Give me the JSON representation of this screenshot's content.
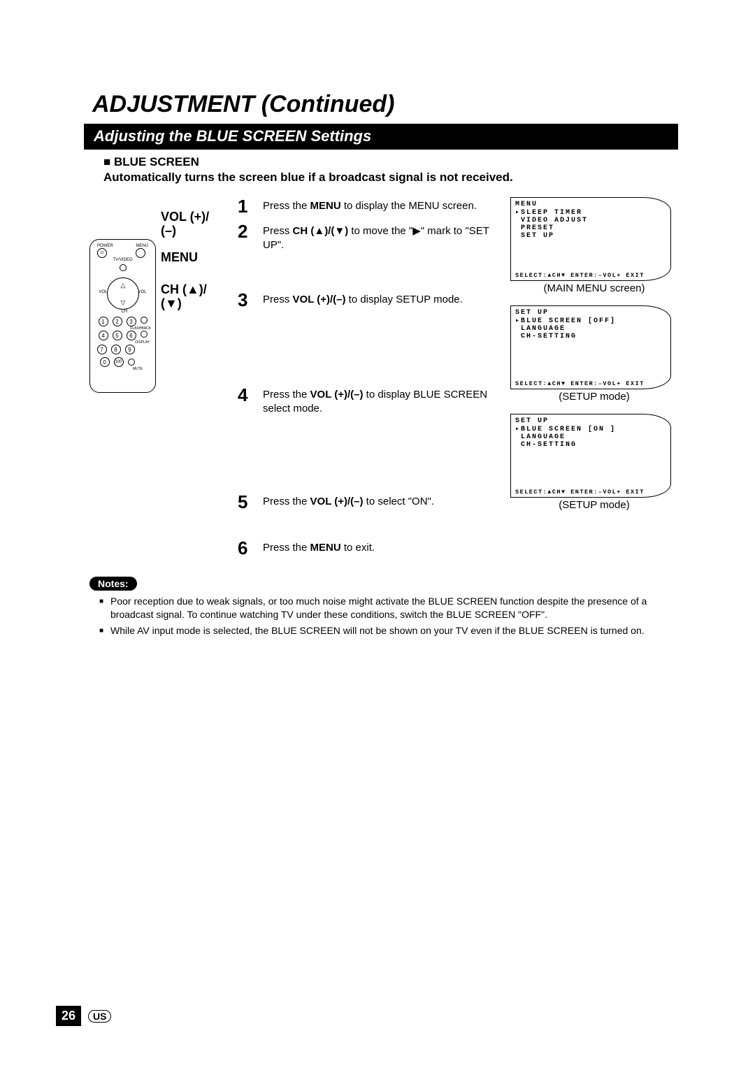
{
  "title": "ADJUSTMENT (Continued)",
  "subtitle": "Adjusting the BLUE SCREEN Settings",
  "intro": {
    "heading": "BLUE SCREEN",
    "description": "Automatically turns the screen blue if a broadcast signal is not received."
  },
  "remote_labels": {
    "vol": "VOL (+)/",
    "vol_line2": "(–)",
    "menu": "MENU",
    "ch": "CH (▲)/",
    "ch_line2": "(▼)"
  },
  "remote_text": {
    "power": "POWER",
    "menu": "MENU",
    "tvvideo": "TV/VIDEO",
    "vol": "VOL",
    "ch": "CH",
    "flashback": "FLASHBACK",
    "display": "DISPLAY",
    "mute": "MUTE",
    "hundred": "100"
  },
  "steps": [
    {
      "num": "1",
      "text_a": "Press the ",
      "bold_a": "MENU",
      "text_b": " to display the MENU screen."
    },
    {
      "num": "2",
      "text_a": "Press ",
      "bold_a": "CH (▲)/(▼)",
      "text_b": " to move the \"▶\" mark to \"SET UP\"."
    },
    {
      "num": "3",
      "text_a": "Press ",
      "bold_a": "VOL (+)/(–)",
      "text_b": " to display SETUP mode."
    },
    {
      "num": "4",
      "text_a": "Press the ",
      "bold_a": "VOL (+)/(–)",
      "text_b": " to display BLUE SCREEN select mode."
    },
    {
      "num": "5",
      "text_a": "Press the ",
      "bold_a": "VOL (+)/(–)",
      "text_b": " to select \"ON\"."
    },
    {
      "num": "6",
      "text_a": "Press the ",
      "bold_a": "MENU",
      "text_b": " to exit."
    }
  ],
  "screens": [
    {
      "title": "MENU",
      "lines": [
        "SLEEP TIMER",
        "VIDEO ADJUST",
        "PRESET",
        "SET UP"
      ],
      "pointer_index": 0,
      "footer": "SELECT:▲CH▼ ENTER:–VOL+ EXIT",
      "caption": "(MAIN MENU screen)"
    },
    {
      "title": "SET UP",
      "lines": [
        "BLUE SCREEN [OFF]",
        "LANGUAGE",
        "CH-SETTING"
      ],
      "pointer_index": 0,
      "footer": "SELECT:▲CH▼ ENTER:–VOL+ EXIT",
      "caption": "(SETUP mode)"
    },
    {
      "title": "SET UP",
      "lines": [
        "BLUE SCREEN [ON ]",
        "LANGUAGE",
        "CH-SETTING"
      ],
      "pointer_index": 0,
      "footer": "SELECT:▲CH▼ ENTER:–VOL+ EXIT",
      "caption": "(SETUP mode)"
    }
  ],
  "notes_label": "Notes:",
  "notes": [
    "Poor reception due to weak signals, or too much noise might activate the BLUE SCREEN function despite the presence of a broadcast signal. To continue watching TV under these conditions, switch the BLUE SCREEN \"OFF\".",
    "While AV input mode is selected, the BLUE SCREEN will not be shown on your TV even if the BLUE SCREEN is turned on."
  ],
  "page_number": "26",
  "region": "US"
}
